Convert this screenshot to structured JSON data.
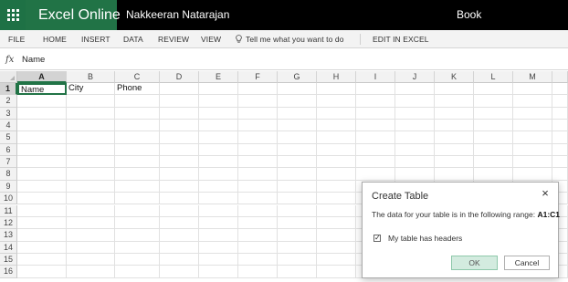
{
  "app": {
    "brand": "Excel Online",
    "user": "Nakkeeran Natarajan",
    "document_title": "Book",
    "brand_color": "#217346"
  },
  "ribbon": {
    "file": "FILE",
    "home": "HOME",
    "insert": "INSERT",
    "data": "DATA",
    "review": "REVIEW",
    "view": "VIEW",
    "tell_me": "Tell me what you want to do",
    "edit_in_excel": "EDIT IN EXCEL"
  },
  "formula_bar": {
    "icon": "fx",
    "value": "Name"
  },
  "sheet": {
    "columns": [
      "A",
      "B",
      "C",
      "D",
      "E",
      "F",
      "G",
      "H",
      "I",
      "J",
      "K",
      "L",
      "M"
    ],
    "rows": [
      "1",
      "2",
      "3",
      "4",
      "5",
      "6",
      "7",
      "8",
      "9",
      "10",
      "11",
      "12",
      "13",
      "14",
      "15",
      "16"
    ],
    "selected_column": "A",
    "selected_row": "1",
    "cells": {
      "A1": "Name",
      "B1": "City",
      "C1": "Phone"
    }
  },
  "dialog": {
    "title": "Create Table",
    "message": "The data for your table is in the following range:",
    "range": "A1:C1",
    "checkbox_label": "My table has headers",
    "checkbox_checked": true,
    "ok_label": "OK",
    "cancel_label": "Cancel",
    "close_glyph": "×"
  }
}
